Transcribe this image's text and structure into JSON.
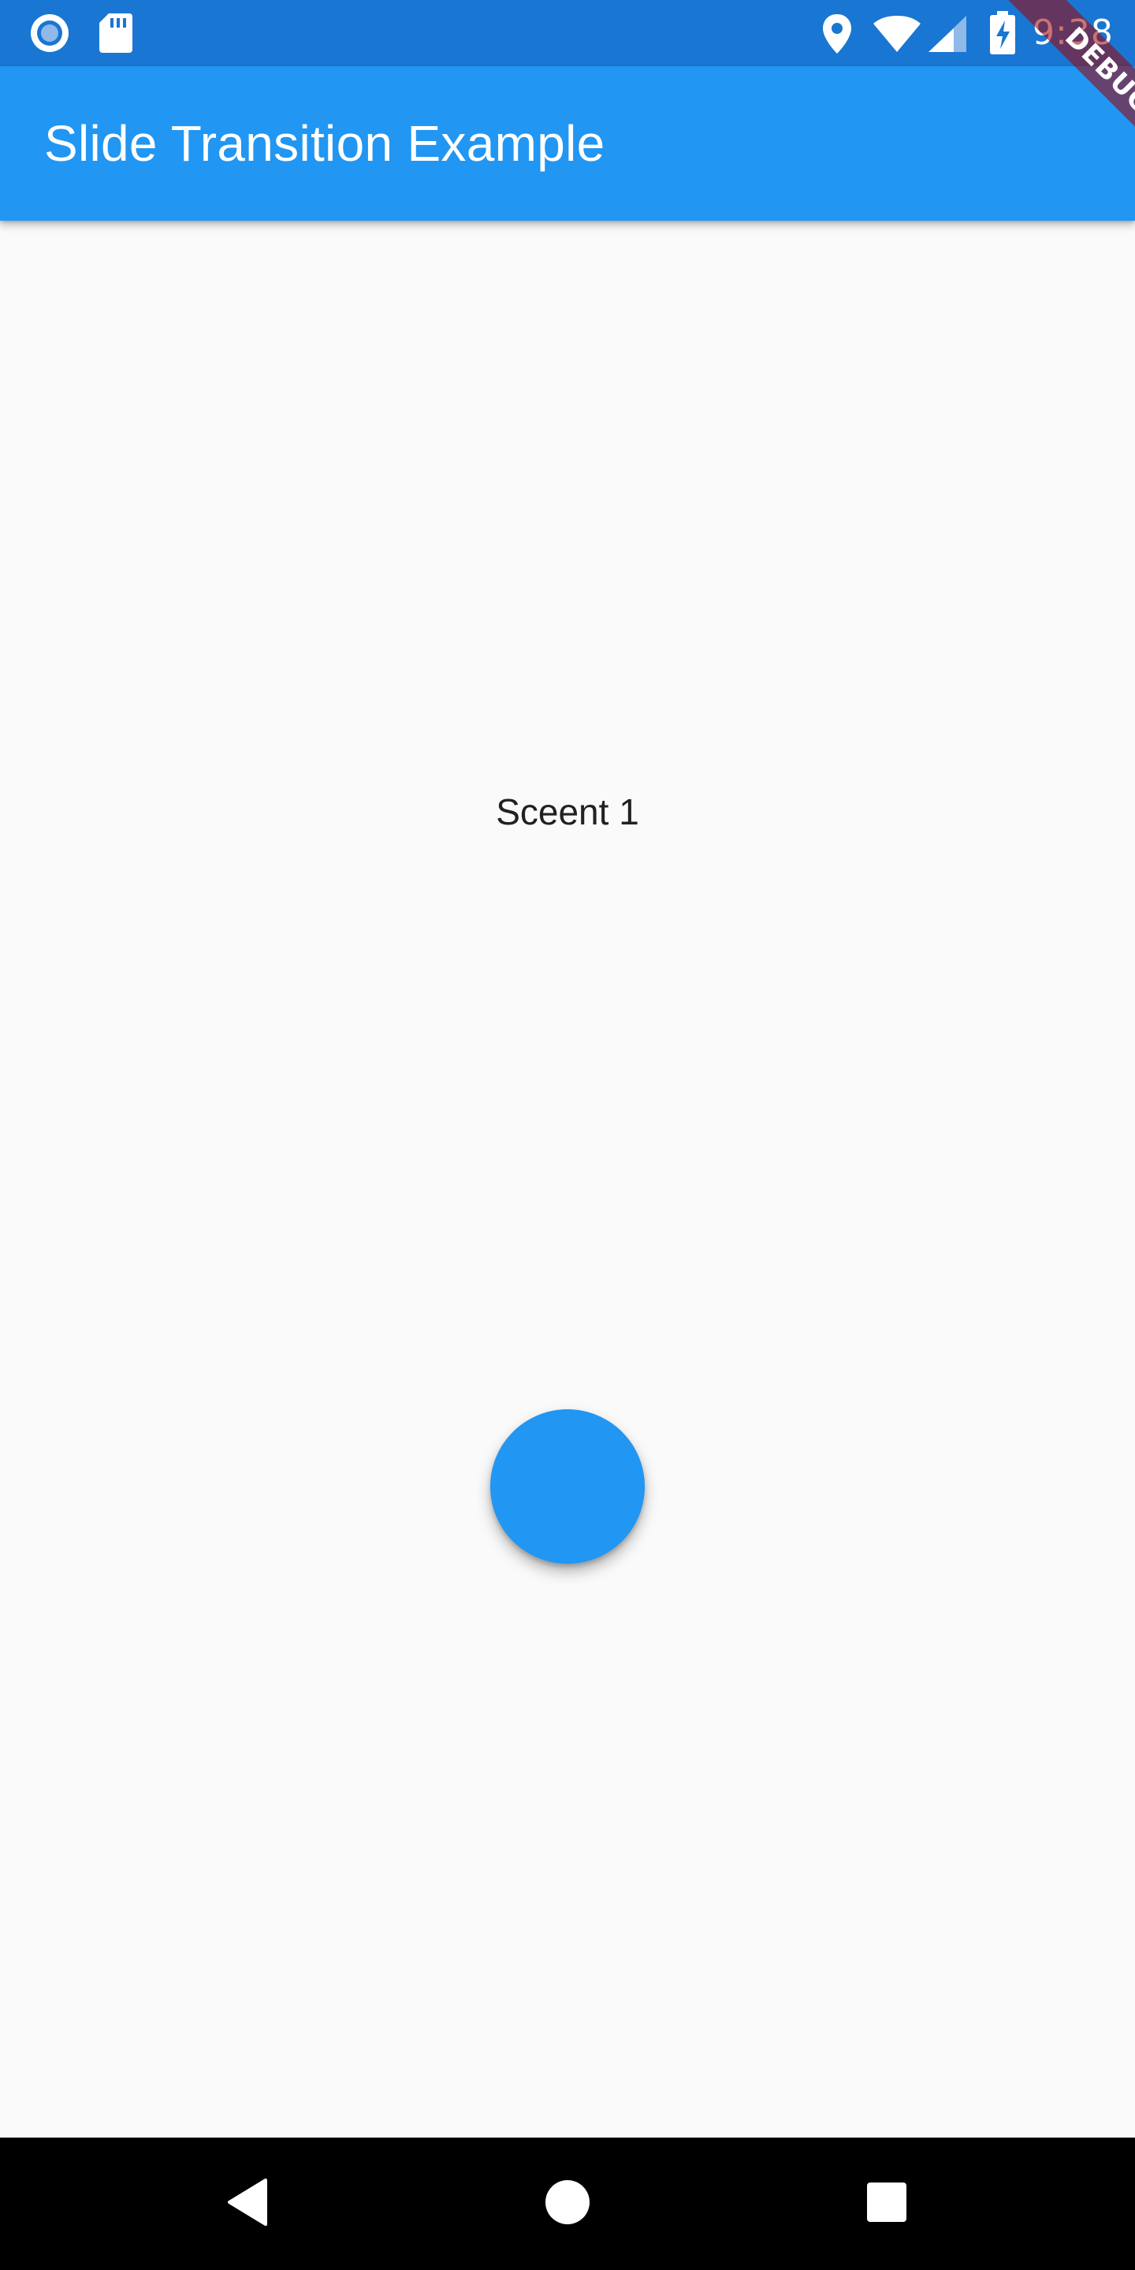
{
  "status_bar": {
    "time": "9:38",
    "background_color": "#1976d2",
    "left_icons": [
      "record-icon",
      "sd-card-icon"
    ],
    "right_icons": [
      "location-icon",
      "wifi-icon",
      "signal-icon",
      "battery-charging-icon"
    ]
  },
  "app_bar": {
    "title": "Slide Transition Example",
    "background_color": "#2196f3"
  },
  "debug_banner": {
    "label": "DEBUG"
  },
  "body": {
    "scene_text": "Sceent 1",
    "background_color": "#fafafa"
  },
  "fab": {
    "color": "#2196f3"
  },
  "nav_bar": {
    "buttons": [
      "back-icon",
      "home-icon",
      "recents-icon"
    ]
  }
}
